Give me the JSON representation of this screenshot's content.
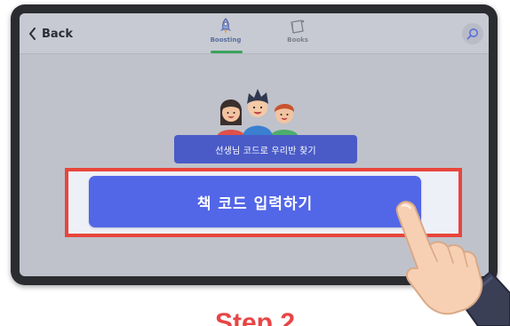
{
  "topbar": {
    "back_label": "Back",
    "tabs": [
      {
        "label": "Boosting",
        "icon": "rocket-icon",
        "active": true
      },
      {
        "label": "Books",
        "icon": "book-icon",
        "active": false
      }
    ],
    "search_icon": "search-icon"
  },
  "main": {
    "find_class_label": "선생님 코드로 우리반 찾기",
    "enter_code_label": "책 코드 입력하기"
  },
  "overlay": {
    "step_label": "Step 2",
    "highlight_color": "#e8453c"
  },
  "colors": {
    "primary_button": "#5266e8",
    "secondary_button": "#4a5bc8",
    "active_tab_underline": "#3aa35c"
  }
}
